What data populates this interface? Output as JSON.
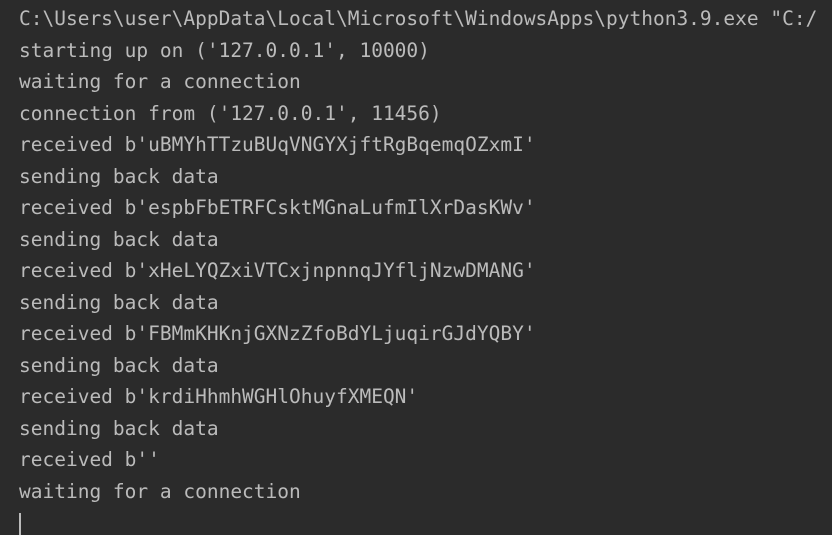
{
  "console": {
    "lines": [
      "C:\\Users\\user\\AppData\\Local\\Microsoft\\WindowsApps\\python3.9.exe \"C:/",
      "starting up on ('127.0.0.1', 10000)",
      "waiting for a connection",
      "connection from ('127.0.0.1', 11456)",
      "received b'uBMYhTTzuBUqVNGYXjftRgBqemqOZxmI'",
      "sending back data",
      "received b'espbFbETRFCsktMGnaLufmIlXrDasKWv'",
      "sending back data",
      "received b'xHeLYQZxiVTCxjnpnnqJYfljNzwDMANG'",
      "sending back data",
      "received b'FBMmKHKnjGXNzZfoBdYLjuqirGJdYQBY'",
      "sending back data",
      "received b'krdiHhmhWGHlOhuyfXMEQN'",
      "sending back data",
      "received b''",
      "waiting for a connection"
    ]
  },
  "colors": {
    "background": "#2b2b2b",
    "text": "#bbbbbb"
  }
}
